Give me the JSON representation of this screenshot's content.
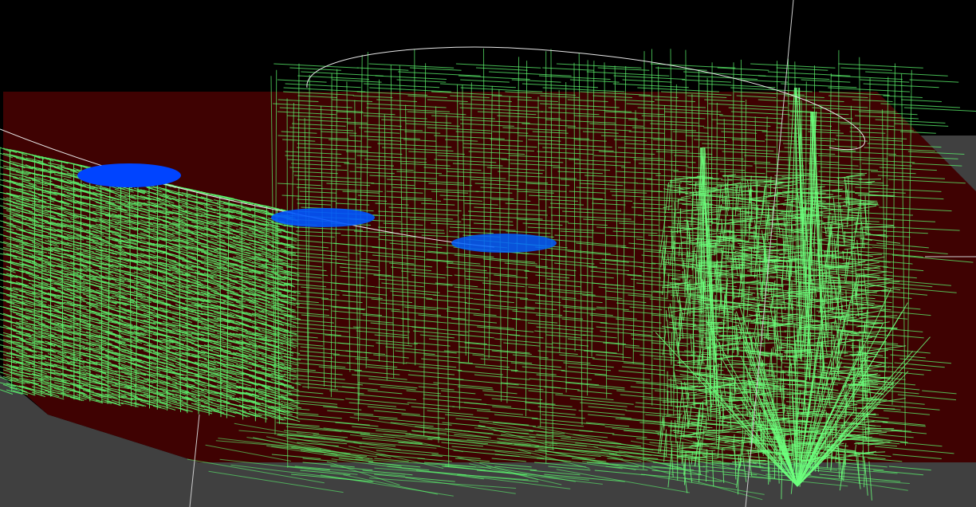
{
  "scene": {
    "description_visible_text": [],
    "colors": {
      "background": "#000000",
      "ground_plane": "#3f0202",
      "floor_gray": "#404040",
      "mesh_lines": "#5cf56e",
      "mesh_lines_dense": "#6cff7c",
      "axis_lines": "#cfcfcf",
      "orbit_curve": "#e8e8e8",
      "markers": "#0044ff"
    },
    "icons": [
      "3d-viewport",
      "wireframe-mesh",
      "axis-line",
      "orbit-curve",
      "marker-disc"
    ]
  }
}
